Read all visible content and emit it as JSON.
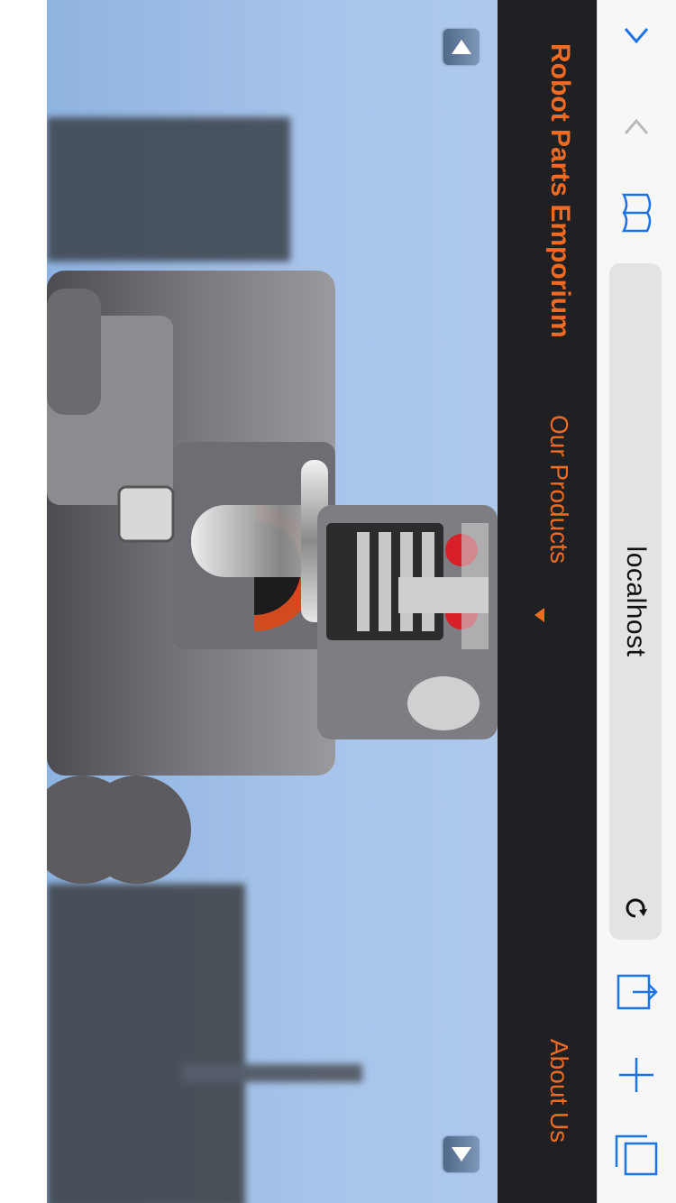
{
  "browser": {
    "address": "localhost",
    "accent_color": "#1a73e8",
    "icons": [
      "chevron-up-icon",
      "chevron-down-icon",
      "bookmarks-icon",
      "reload-icon",
      "share-icon",
      "add-tab-icon",
      "tabs-icon"
    ]
  },
  "site": {
    "brand": "Robot Parts Emporium",
    "nav": {
      "products": "Our Products",
      "about": "About Us"
    },
    "brand_color": "#f06a21",
    "header_bg": "#1e2024"
  },
  "hero": {
    "image": "toy-robot-photo",
    "controls": [
      "scroll-up",
      "scroll-down"
    ]
  }
}
